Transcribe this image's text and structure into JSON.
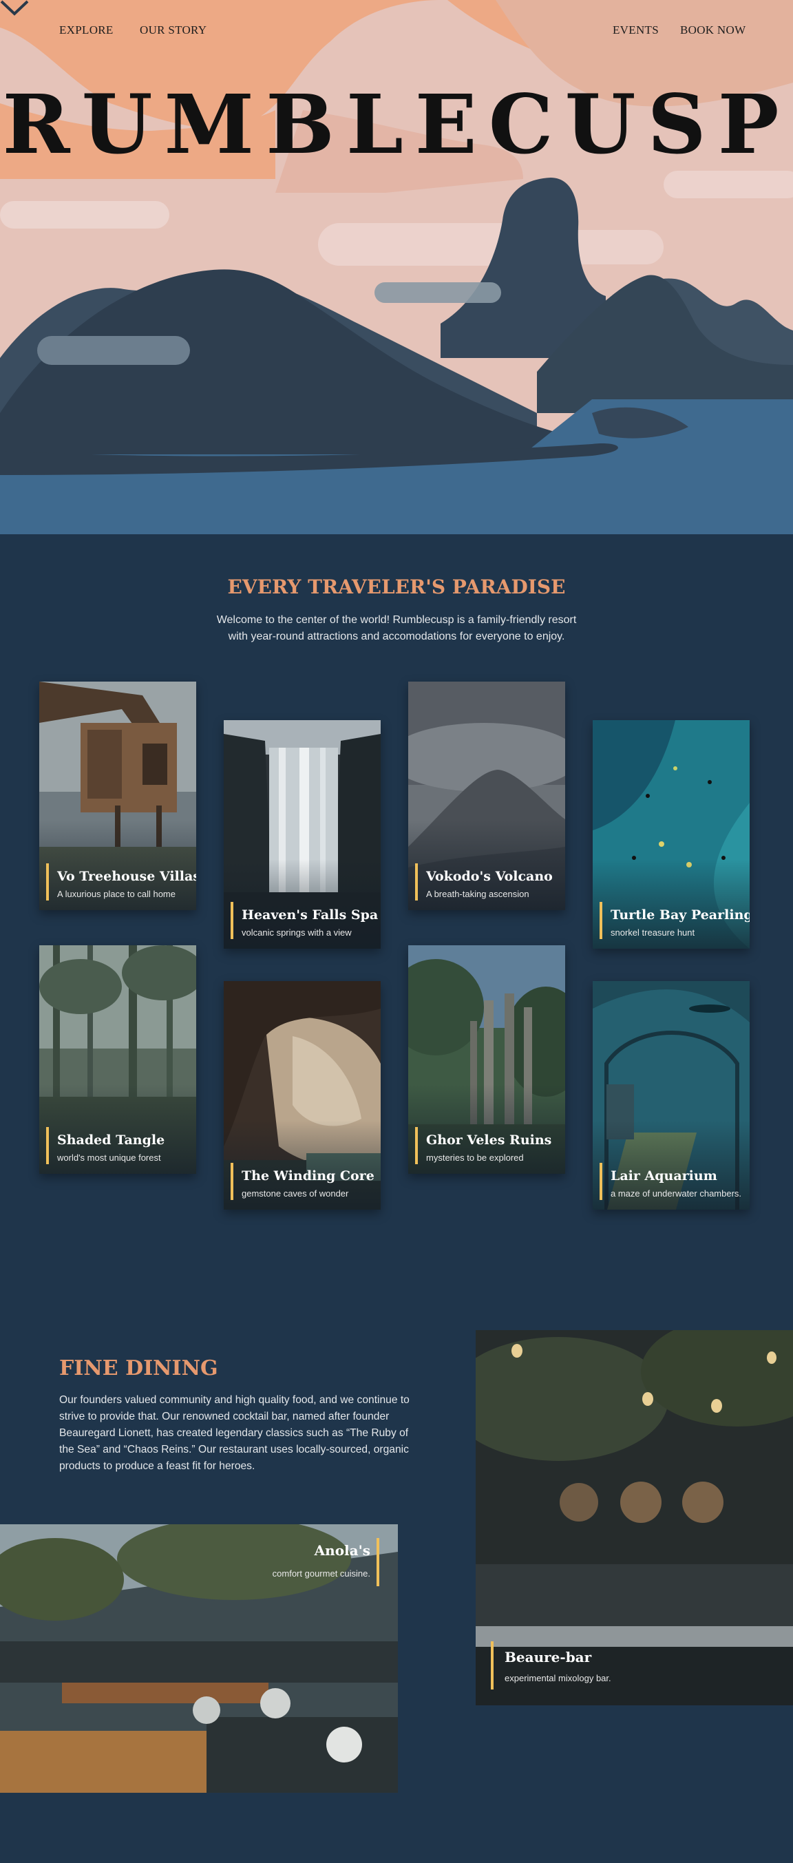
{
  "nav": {
    "explore": "EXPLORE",
    "story": "OUR STORY",
    "events": "EVENTS",
    "book": "BOOK NOW"
  },
  "hero": {
    "title": "RUMBLECUSP"
  },
  "paradise": {
    "heading": "EVERY TRAVELER'S PARADISE",
    "intro": "Welcome to the center of the world! Rumblecusp is a family-friendly resort with year-round attractions and accomodations for everyone to enjoy.",
    "attractions": [
      {
        "name": "Vo Treehouse Villas",
        "desc": "A luxurious place to call home"
      },
      {
        "name": "Heaven's Falls Spa",
        "desc": "volcanic springs with a view"
      },
      {
        "name": "Vokodo's Volcano",
        "desc": "A breath-taking ascension"
      },
      {
        "name": "Turtle Bay Pearling",
        "desc": "snorkel treasure hunt"
      },
      {
        "name": "Shaded Tangle",
        "desc": "world's most unique forest"
      },
      {
        "name": "The Winding Core",
        "desc": "gemstone caves of wonder"
      },
      {
        "name": "Ghor Veles Ruins",
        "desc": "mysteries to be explored"
      },
      {
        "name": "Lair Aquarium",
        "desc": "a maze of underwater chambers."
      }
    ]
  },
  "dining": {
    "heading": "FINE DINING",
    "body": "Our founders valued community and high quality food, and we continue to strive to provide that. Our renowned cocktail bar, named after founder Beauregard Lionett, has created legendary classics such as “The Ruby of the Sea” and “Chaos Reins.” Our restaurant uses locally-sourced, organic products to produce a feast fit for heroes.",
    "restaurant": {
      "name": "Anola's",
      "desc": "comfort gourmet cuisine."
    },
    "bar": {
      "name": "Beaure-bar",
      "desc": "experimental mixology bar."
    }
  },
  "colors": {
    "accent": "#e6996e",
    "background": "#1f354b",
    "highlight": "#f0c05a"
  },
  "icons": {
    "scroll": "chevron-down-icon"
  }
}
